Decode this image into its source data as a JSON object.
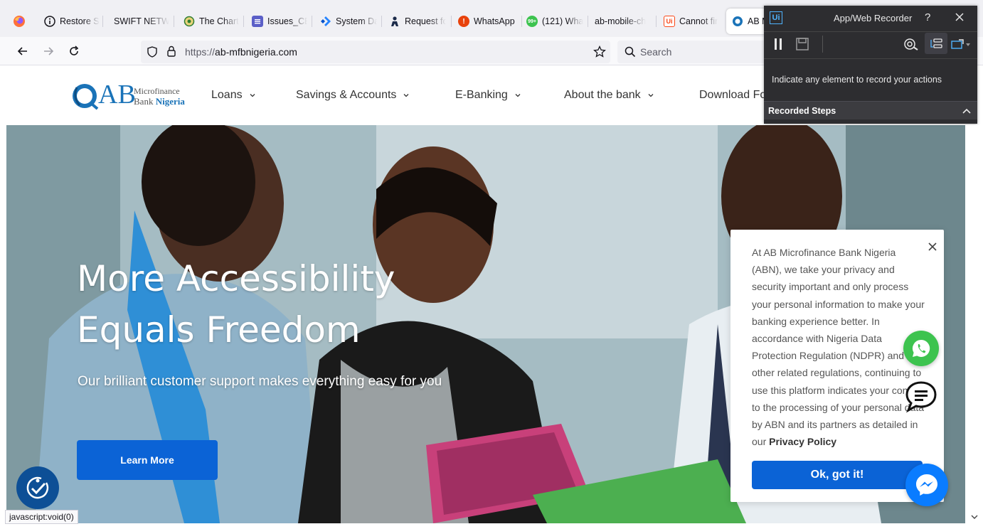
{
  "browser": {
    "tabs": [
      {
        "title": "Restore Se",
        "icon": "info-icon"
      },
      {
        "title": "SWIFT NETWC",
        "icon": "none"
      },
      {
        "title": "The Chart",
        "icon": "crest-icon"
      },
      {
        "title": "Issues_CBI",
        "icon": "teams-icon"
      },
      {
        "title": "System Da",
        "icon": "jira-icon"
      },
      {
        "title": "Request fo",
        "icon": "person-icon"
      },
      {
        "title": "WhatsApp",
        "icon": "alert-icon"
      },
      {
        "title": "(121) Wha",
        "icon": "whatsapp-icon",
        "badge": "99+"
      },
      {
        "title": "ab-mobile-ch",
        "icon": "none"
      },
      {
        "title": "Cannot fir",
        "icon": "uipath-icon"
      },
      {
        "title": "AB M",
        "icon": "ab-logo-icon",
        "active": true
      }
    ],
    "url_scheme": "https://",
    "url_host": "ab-mfbnigeria.com",
    "search_placeholder": "Search",
    "status_text": "javascript:void(0)"
  },
  "site": {
    "logo_letters": "AB",
    "logo_line1": "Microfinance",
    "logo_line2_a": "Bank ",
    "logo_line2_b": "Nigeria",
    "menu": [
      "Loans",
      "Savings & Accounts",
      "E-Banking",
      "About the bank",
      "Download Fo"
    ],
    "hero_title_line1": "More Accessibility",
    "hero_title_line2": "Equals Freedom",
    "hero_subtitle": "Our brilliant customer support makes everything easy for you",
    "learn_more": "Learn More"
  },
  "cookie": {
    "text": "At AB Microfinance Bank Nigeria (ABN), we take your privacy and security important and only process your personal information to make your banking experience better. In accordance with Nigeria Data Protection Regulation (NDPR) and other related regulations, continuing to use this platform indicates your consent to the processing of your personal data by ABN and its partners as detailed in our ",
    "policy_link": "Privacy Policy",
    "ok_button": "Ok, got it!"
  },
  "recorder": {
    "title": "App/Web Recorder",
    "help": "?",
    "hint": "Indicate any element to record your actions",
    "steps_label": "Recorded Steps"
  },
  "colors": {
    "brand_blue": "#0b63d6",
    "logo_blue": "#1a73b8",
    "logo_red": "#d32f2f",
    "whatsapp_green": "#3dc34f",
    "messenger_blue": "#0a7cff",
    "recorder_bg": "#2d2d30"
  }
}
